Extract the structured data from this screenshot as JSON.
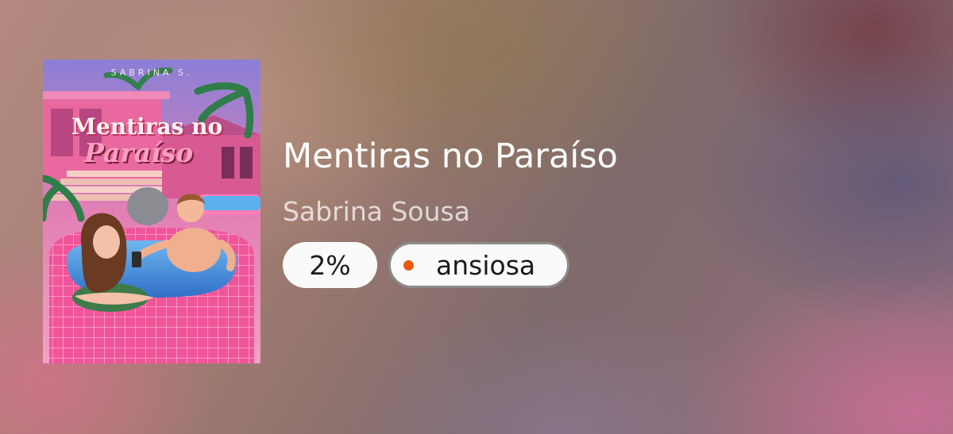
{
  "book": {
    "title": "Mentiras no Paraíso",
    "author": "Sabrina Sousa",
    "cover": {
      "author_text": "SABRINA S.",
      "title_line1": "Mentiras no",
      "title_line2": "Paraíso"
    }
  },
  "progress": {
    "label": "2%",
    "value": 0.02
  },
  "status": {
    "label": "ansiosa",
    "dot_color": "#e8590c"
  }
}
